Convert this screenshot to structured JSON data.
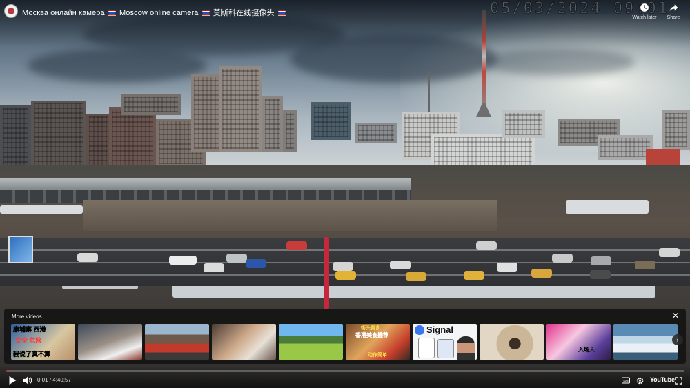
{
  "player": {
    "title_ru": "Москва онлайн камера",
    "title_en": "Moscow online camera",
    "title_zh": "莫斯科在线摄像头",
    "camera_timestamp": "05/03/2024 09:01",
    "watch_later_label": "Watch later",
    "share_label": "Share",
    "icons": {
      "channel": "channel-avatar",
      "watch_later": "clock-icon",
      "share": "share-arrow-icon"
    }
  },
  "more_videos": {
    "heading": "More videos",
    "close_glyph": "✕",
    "next_glyph": "›",
    "thumbnails": [
      {
        "text_top": "康埔寨 西港",
        "text_mid": "安全 危险",
        "text_bottom": "我说了真不算"
      },
      {
        "text_top": "",
        "text_mid": "",
        "text_bottom": ""
      },
      {
        "text_top": "",
        "text_mid": "",
        "text_bottom": ""
      },
      {
        "text_top": "",
        "text_mid": "",
        "text_bottom": ""
      },
      {
        "text_top": "",
        "text_mid": "",
        "text_bottom": ""
      },
      {
        "text_top": "街头美食",
        "text_mid": "香港美食推荐",
        "text_bottom": "动作简单"
      },
      {
        "text_top": "Signal",
        "text_mid": "",
        "text_bottom": ""
      },
      {
        "text_top": "",
        "text_mid": "",
        "text_bottom": ""
      },
      {
        "text_top": "",
        "text_mid": "",
        "text_bottom": "入场人"
      },
      {
        "text_top": "",
        "text_mid": "",
        "text_bottom": ""
      }
    ]
  },
  "controls": {
    "current_time": "0:01",
    "separator": " / ",
    "duration": "4:40:57",
    "progress_fraction": 0.0001,
    "brand": "YouTube",
    "icons": {
      "play": "play-icon",
      "volume": "volume-icon",
      "captions": "captions-icon",
      "settings": "gear-icon",
      "fullscreen": "fullscreen-icon"
    }
  },
  "colors": {
    "progress": "#ff0000",
    "panel_bg": "#121212"
  }
}
